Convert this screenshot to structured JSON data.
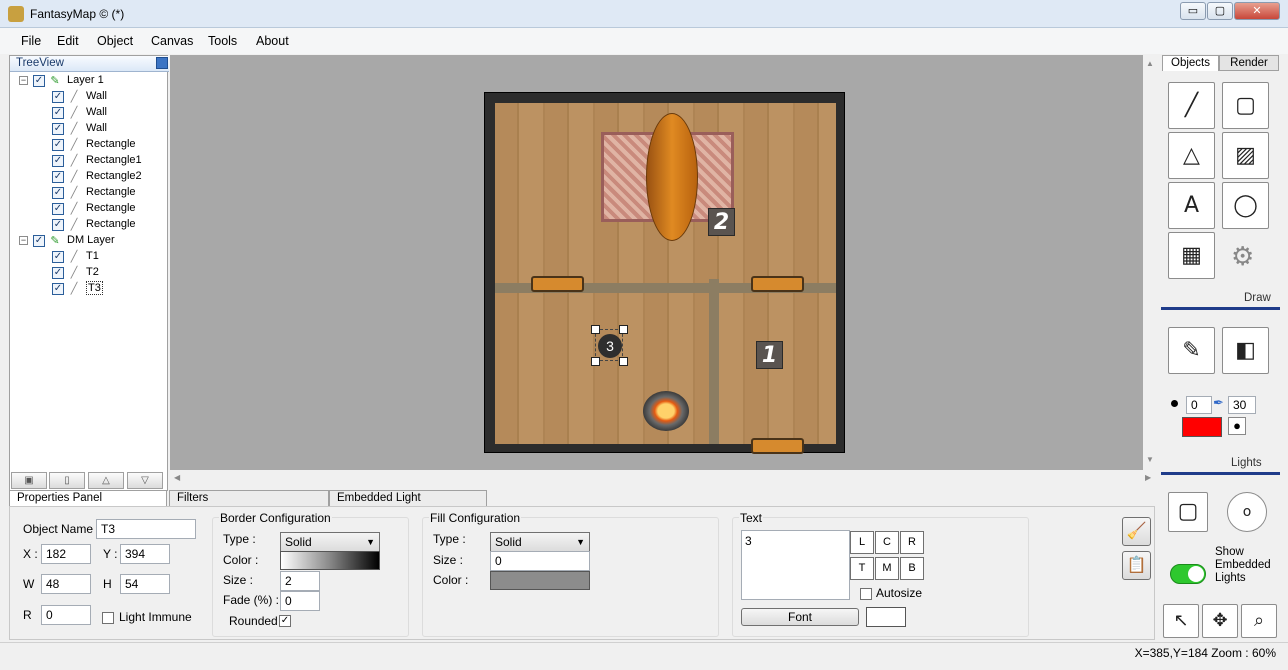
{
  "window": {
    "title": "FantasyMap © (*)",
    "btn_min": "▭",
    "btn_max": "▢",
    "btn_close": "✕"
  },
  "menu": [
    "File",
    "Edit",
    "Object",
    "Canvas",
    "Tools",
    "About"
  ],
  "treeview": {
    "tab_label": "TreeView",
    "layers": [
      {
        "name": "Layer 1",
        "items": [
          "Wall",
          "Wall",
          "Wall",
          "Rectangle",
          "Rectangle1",
          "Rectangle2",
          "Rectangle",
          "Rectangle",
          "Rectangle"
        ]
      },
      {
        "name": "DM Layer",
        "items": [
          "T1",
          "T2",
          "T3"
        ]
      }
    ],
    "selected": "T3",
    "toolbar_icons": [
      "add-layer-icon",
      "delete-layer-icon",
      "move-up-icon",
      "move-down-icon"
    ]
  },
  "map": {
    "tokens": [
      "2",
      "1",
      "3"
    ]
  },
  "right_panel": {
    "tabs": [
      "Objects",
      "Render"
    ],
    "draw_label": "Draw",
    "lights_label": "Lights",
    "brush_size": "0",
    "light_radius": "30",
    "color": "#ff0000",
    "show_lights_label": "Show Embedded Lights"
  },
  "bottom_tabs": [
    "Properties Panel",
    "Filters",
    "Embedded Light"
  ],
  "properties": {
    "object_name_label": "Object Name",
    "object_name": "T3",
    "x_label": "X :",
    "x": "182",
    "y_label": "Y :",
    "y": "394",
    "w_label": "W",
    "w": "48",
    "h_label": "H",
    "h": "54",
    "r_label": "R",
    "r": "0",
    "light_immune_label": "Light Immune",
    "border": {
      "title": "Border Configuration",
      "type_label": "Type :",
      "type": "Solid",
      "color_label": "Color :",
      "size_label": "Size :",
      "size": "2",
      "fade_label": "Fade (%) :",
      "fade": "0",
      "rounded_label": "Rounded"
    },
    "fill": {
      "title": "Fill Configuration",
      "type_label": "Type :",
      "type": "Solid",
      "size_label": "Size :",
      "size": "0",
      "color_label": "Color :",
      "color": "#8c8c8c"
    },
    "text": {
      "title": "Text",
      "value": "3",
      "align_buttons": [
        "L",
        "C",
        "R",
        "T",
        "M",
        "B"
      ],
      "autosize_label": "Autosize",
      "font_button": "Font"
    }
  },
  "status": "X=385,Y=184  Zoom : 60%"
}
